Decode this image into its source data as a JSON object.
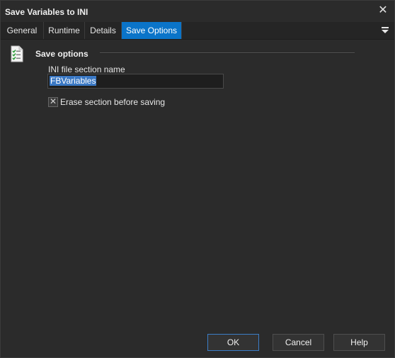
{
  "window": {
    "title": "Save Variables to INI"
  },
  "tabs": [
    {
      "label": "General"
    },
    {
      "label": "Runtime"
    },
    {
      "label": "Details"
    },
    {
      "label": "Save Options",
      "active": true
    }
  ],
  "group": {
    "title": "Save options"
  },
  "section_field": {
    "label": "INI file section name",
    "value": "FBVariables"
  },
  "erase_option": {
    "label": "Erase section before saving",
    "checked": true
  },
  "buttons": {
    "ok": "OK",
    "cancel": "Cancel",
    "help": "Help"
  },
  "colors": {
    "background": "#2b2b2b",
    "tab_active": "#0a74c9",
    "selection": "#3a78c4"
  },
  "icons": {
    "close": "close-icon",
    "tab_menu": "menu-dropdown-icon",
    "group": "checklist-document-icon"
  }
}
